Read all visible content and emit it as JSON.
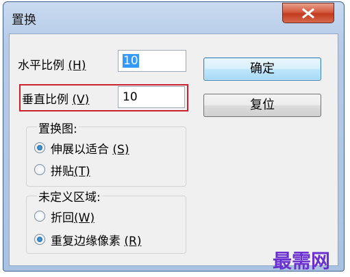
{
  "window": {
    "title": "置换"
  },
  "fields": {
    "horizontal": {
      "label": "水平比例",
      "accel": "(H)",
      "value": "10"
    },
    "vertical": {
      "label": "垂直比例",
      "accel": "(V)",
      "value": "10"
    }
  },
  "buttons": {
    "ok": "确定",
    "reset": "复位"
  },
  "displacement_map": {
    "title": "置换图:",
    "options": [
      {
        "label": "伸展以适合",
        "accel": "(S)",
        "checked": true
      },
      {
        "label": "拼贴",
        "accel": "(T)",
        "checked": false
      }
    ]
  },
  "undefined_areas": {
    "title": "未定义区域:",
    "options": [
      {
        "label": "折回",
        "accel": "(W)",
        "checked": false
      },
      {
        "label": "重复边缘像素",
        "accel": "(R)",
        "checked": true
      }
    ]
  },
  "watermark": "最需网",
  "colors": {
    "highlight_border": "#c8212b",
    "selection": "#3399ff",
    "watermark": "#6a2fd0"
  }
}
